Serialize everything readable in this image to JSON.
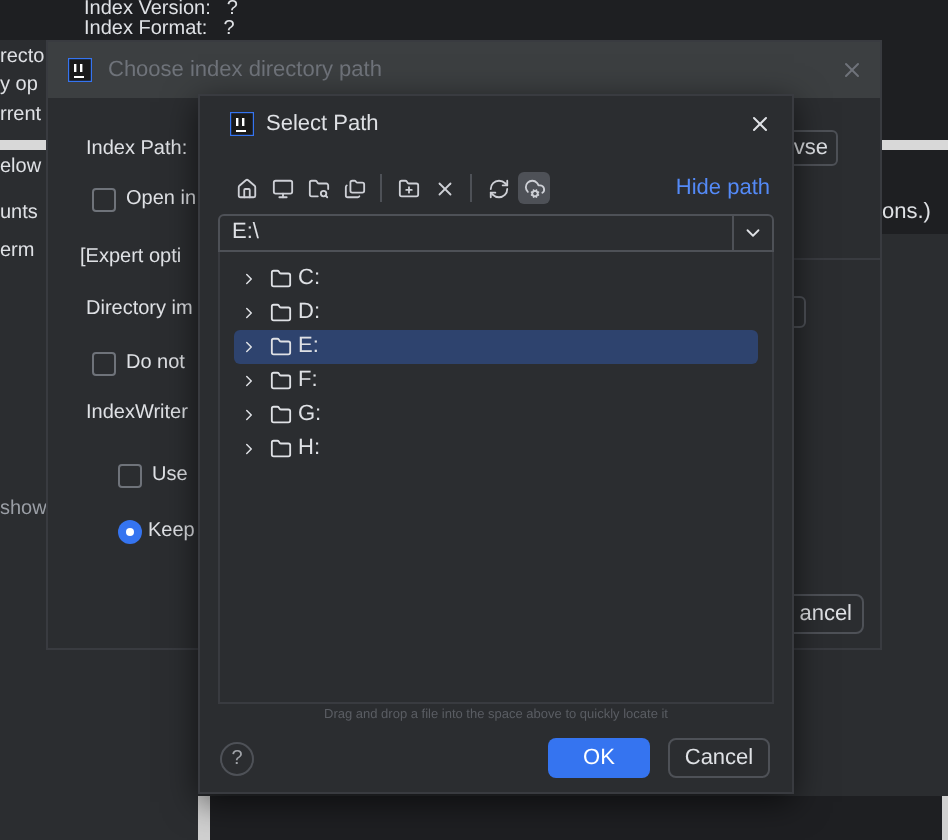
{
  "background_app": {
    "header_rows": [
      {
        "label": "Index Version:",
        "value": "?"
      },
      {
        "label": "Index Format:",
        "value": "?"
      }
    ],
    "left_fragments": [
      "recto",
      "y op",
      "rrent",
      "elow",
      "unts",
      "erm"
    ],
    "lower_left_fragment": "show",
    "right_fragment": "ons.)"
  },
  "index_dialog": {
    "title": "Choose index directory path",
    "index_path_label": "Index Path:",
    "browse_button": "vse",
    "options": [
      {
        "kind": "checkbox",
        "label": "Open in",
        "checked": false
      },
      {
        "kind": "text",
        "label": "[Expert opti"
      },
      {
        "kind": "text",
        "label": "Directory im"
      },
      {
        "kind": "checkbox",
        "label": "Do not",
        "checked": false
      },
      {
        "kind": "text",
        "label": "IndexWriter"
      },
      {
        "kind": "checkbox",
        "label": "Use",
        "checked": false
      },
      {
        "kind": "radio",
        "label": "Keep",
        "selected": true
      }
    ],
    "cancel_button": "ancel"
  },
  "select_path_dialog": {
    "title": "Select Path",
    "toolbar": [
      {
        "selected": false
      },
      {
        "selected": false
      },
      {
        "selected": false
      },
      {
        "selected": false
      },
      {
        "selected": false
      },
      {
        "selected": false
      },
      {
        "selected": false
      },
      {
        "selected": true
      }
    ],
    "hide_path_link": "Hide path",
    "path_value": "E:\\",
    "tree": [
      {
        "label": "C:",
        "expanded": false,
        "selected": false
      },
      {
        "label": "D:",
        "expanded": false,
        "selected": false
      },
      {
        "label": "E:",
        "expanded": false,
        "selected": true
      },
      {
        "label": "F:",
        "expanded": false,
        "selected": false
      },
      {
        "label": "G:",
        "expanded": false,
        "selected": false
      },
      {
        "label": "H:",
        "expanded": false,
        "selected": false
      }
    ],
    "hint": "Drag and drop a file into the space above to quickly locate it",
    "help_button": "?",
    "ok_button": "OK",
    "cancel_button": "Cancel"
  }
}
